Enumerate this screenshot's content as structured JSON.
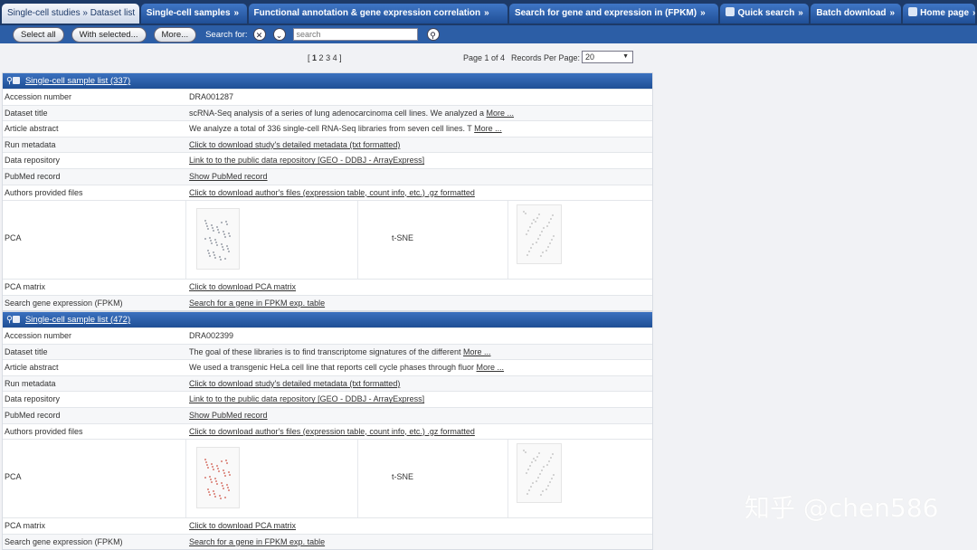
{
  "tabs": [
    {
      "label": "Single-cell studies » Dataset list",
      "active": true
    },
    {
      "label": "Single-cell samples",
      "active": false
    },
    {
      "label": "Functional annotation & gene expression correlation",
      "active": false
    },
    {
      "label": "Search for gene and expression in (FPKM)",
      "active": false
    },
    {
      "label": "Quick search",
      "active": false,
      "icon": "grid-icon"
    },
    {
      "label": "Batch download",
      "active": false
    },
    {
      "label": "Home page",
      "active": false,
      "icon": "home-icon"
    }
  ],
  "tab_separator": "»",
  "toolbar": {
    "select_all": "Select all",
    "with_selected": "With selected...",
    "more": "More...",
    "search_for": "Search for:",
    "search_placeholder": "search"
  },
  "pager": {
    "pages": [
      "1",
      "2",
      "3",
      "4"
    ],
    "current_page": "1",
    "page_info": "Page 1 of 4",
    "records_label": "Records Per Page:",
    "records_value": "20"
  },
  "labels": {
    "accession": "Accession number",
    "dataset_title": "Dataset title",
    "abstract": "Article abstract",
    "run_metadata": "Run metadata",
    "data_repo": "Data repository",
    "pubmed": "PubMed record",
    "author_files": "Authors provided files",
    "pca": "PCA",
    "tsne": "t-SNE",
    "pca_matrix": "PCA matrix",
    "search_gene": "Search gene expression (FPKM)"
  },
  "links": {
    "more": "More ...",
    "run_metadata": "Click to download study's detailed metadata (txt formatted)",
    "data_repo": "Link to to the public data repository [GEO - DDBJ - ArrayExpress]",
    "pubmed": "Show PubMed record",
    "author_files": "Click to download author's files (expression table, count info, etc.) .gz formatted",
    "pca_matrix": "Click to download PCA matrix",
    "search_gene": "Search for a gene in FPKM exp. table"
  },
  "samples": [
    {
      "header": "Single-cell sample list (337)",
      "accession": "DRA001287",
      "title": "scRNA-Seq analysis of a series of lung adenocarcinoma cell lines. We analyzed a",
      "abstract": "We analyze a total of 336 single-cell RNA-Seq libraries from seven cell lines. T",
      "pca_color": "#9aa0a8"
    },
    {
      "header": "Single-cell sample list (472)",
      "accession": "DRA002399",
      "title": "The goal of these libraries is to find transcriptome signatures of the different",
      "abstract": "We used a transgenic HeLa cell line that reports cell cycle phases through fluor",
      "pca_color": "#d97a6e"
    }
  ],
  "watermark": "知乎 @chen586"
}
